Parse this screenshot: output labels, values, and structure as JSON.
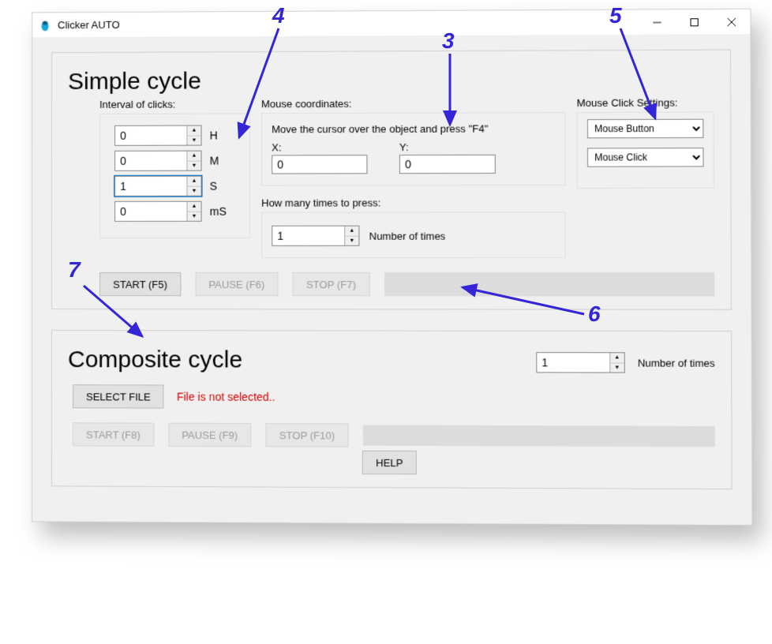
{
  "window": {
    "title": "Clicker AUTO"
  },
  "simple": {
    "title": "Simple cycle",
    "interval": {
      "label": "Interval of clicks:",
      "h": "0",
      "h_unit": "H",
      "m": "0",
      "m_unit": "M",
      "s": "1",
      "s_unit": "S",
      "ms": "0",
      "ms_unit": "mS"
    },
    "coords": {
      "label": "Mouse coordinates:",
      "help": "Move the cursor over the object and press \"F4\"",
      "x_label": "X:",
      "x": "0",
      "y_label": "Y:",
      "y": "0"
    },
    "times": {
      "label": "How many times to press:",
      "value": "1",
      "suffix": "Number of times"
    },
    "settings": {
      "label": "Mouse Click Settings:",
      "button_combo": "Mouse Button",
      "click_combo": "Mouse Click"
    },
    "buttons": {
      "start": "START (F5)",
      "pause": "PAUSE (F6)",
      "stop": "STOP (F7)"
    }
  },
  "composite": {
    "title": "Composite cycle",
    "times_value": "1",
    "times_suffix": "Number of times",
    "select_file": "SELECT FILE",
    "file_status": "File is not selected..",
    "buttons": {
      "start": "START (F8)",
      "pause": "PAUSE (F9)",
      "stop": "STOP (F10)"
    },
    "help": "HELP"
  },
  "annotations": {
    "a3": "3",
    "a4": "4",
    "a5": "5",
    "a6": "6",
    "a7": "7"
  }
}
